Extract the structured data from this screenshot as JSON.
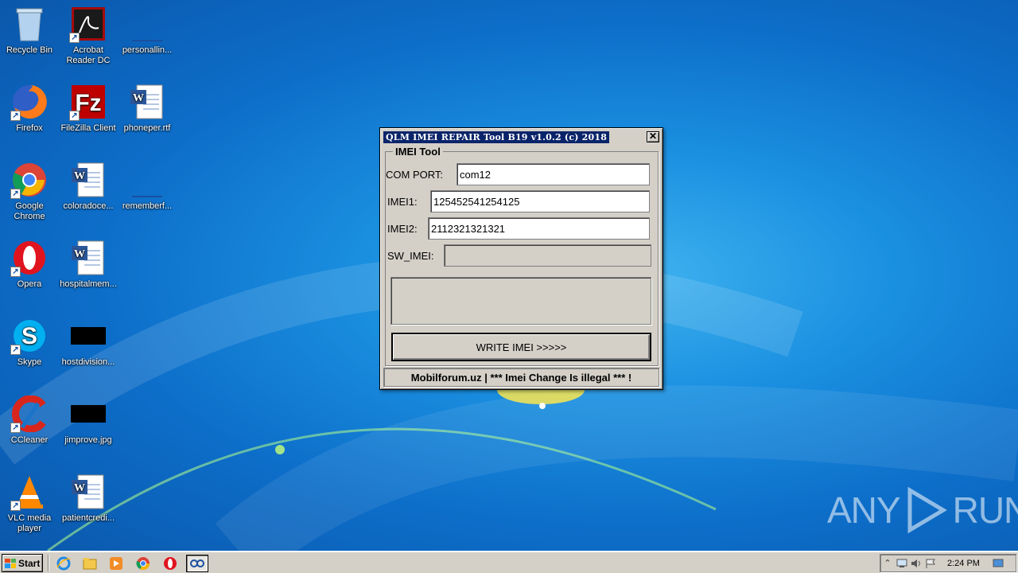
{
  "desktop": {
    "icons": [
      {
        "label": "Recycle Bin"
      },
      {
        "label": "Acrobat Reader DC"
      },
      {
        "label": "personallin..."
      },
      {
        "label": "Firefox"
      },
      {
        "label": "FileZilla Client"
      },
      {
        "label": "phoneper.rtf"
      },
      {
        "label": "Google Chrome"
      },
      {
        "label": "coloradoce..."
      },
      {
        "label": "rememberf..."
      },
      {
        "label": "Opera"
      },
      {
        "label": "hospitalmem..."
      },
      {
        "label": "Skype"
      },
      {
        "label": "hostdivision..."
      },
      {
        "label": "CCleaner"
      },
      {
        "label": "jimprove.jpg"
      },
      {
        "label": "VLC media player"
      },
      {
        "label": "patientcredi..."
      }
    ]
  },
  "dialog": {
    "title": "QLM IMEI REPAIR Tool B19 v1.0.2 (c) 2018",
    "close_label": "✕",
    "group_title": "IMEI Tool",
    "com_port_label": "COM PORT:",
    "com_port_value": "com12",
    "imei1_label": "IMEI1:",
    "imei1_value": "125452541254125",
    "imei2_label": "IMEI2:",
    "imei2_value": "2112321321321",
    "sw_imei_label": "SW_IMEI:",
    "sw_imei_value": "",
    "write_button_label": "WRITE IMEI >>>>>",
    "status_text": "Mobilforum.uz | *** Imei Change Is illegal *** !"
  },
  "taskbar": {
    "start_label": "Start",
    "clock": "2:24 PM"
  },
  "watermark": {
    "left": "ANY",
    "right": "RUN"
  }
}
